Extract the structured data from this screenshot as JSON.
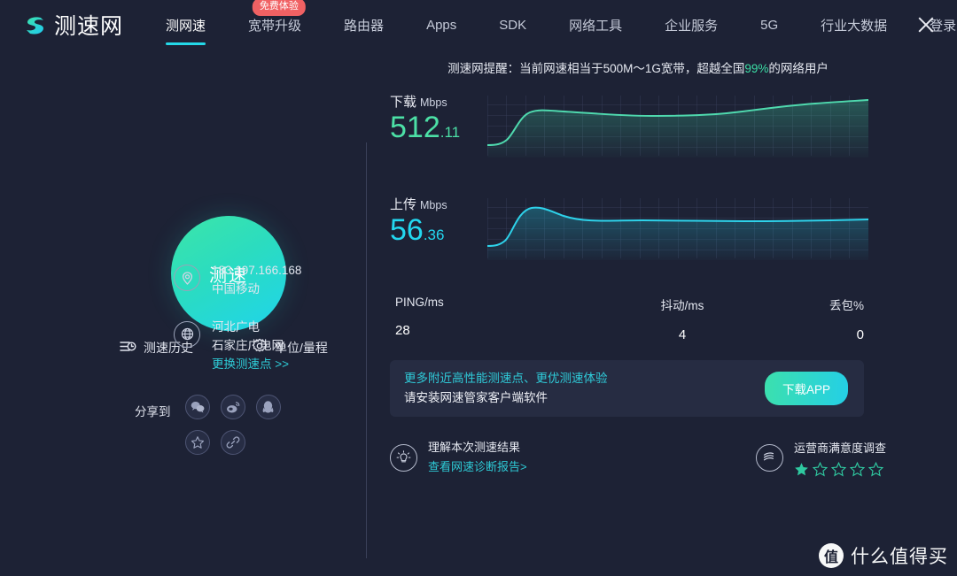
{
  "nav": {
    "logo_text": "测速网",
    "items": [
      {
        "label": "测网速",
        "active": true,
        "badge": null
      },
      {
        "label": "宽带升级",
        "active": false,
        "badge": "免费体验"
      },
      {
        "label": "路由器",
        "active": false,
        "badge": null
      },
      {
        "label": "Apps",
        "active": false,
        "badge": null
      },
      {
        "label": "SDK",
        "active": false,
        "badge": null
      },
      {
        "label": "网络工具",
        "active": false,
        "badge": null
      },
      {
        "label": "企业服务",
        "active": false,
        "badge": null
      },
      {
        "label": "5G",
        "active": false,
        "badge": null
      },
      {
        "label": "行业大数据",
        "active": false,
        "badge": null
      },
      {
        "label": "登录",
        "active": false,
        "badge": null
      }
    ],
    "close_icon": "close-icon"
  },
  "left": {
    "gauge_label": "测速",
    "history_label": "测速历史",
    "history_icon": "history-icon",
    "units_label": "单位/量程",
    "units_icon": "gear-icon",
    "ip_address": "183.197.166.168",
    "carrier": "中国移动",
    "location_icon": "location-pin-icon",
    "server_name": "河北广电",
    "server_network": "石家庄广电网",
    "server_icon": "globe-icon",
    "change_server": "更换测速点 >>",
    "share_label": "分享到",
    "share_items": [
      {
        "name": "wechat-icon",
        "glyph": "❤"
      },
      {
        "name": "weibo-icon",
        "glyph": "◎"
      },
      {
        "name": "qq-icon",
        "glyph": "●"
      },
      {
        "name": "favorite-star-icon",
        "glyph": "☆"
      },
      {
        "name": "link-icon",
        "glyph": "⚭"
      }
    ]
  },
  "right": {
    "reminder_prefix": "测速网提醒：",
    "reminder_body_1": "当前网速相当于500M～1G宽带，超越全国",
    "reminder_pct": "99%",
    "reminder_body_2": "的网络用户",
    "download": {
      "label": "下载",
      "unit": "Mbps",
      "int": "512",
      "dec": ".11",
      "color": "#4ce0a6"
    },
    "upload": {
      "label": "上传",
      "unit": "Mbps",
      "int": "56",
      "dec": ".36",
      "color": "#23d7ef"
    },
    "stats": [
      {
        "label": "PING/ms",
        "value": "28"
      },
      {
        "label": "抖动/ms",
        "value": "4"
      },
      {
        "label": "丢包%",
        "value": "0"
      }
    ],
    "promo": {
      "line1": "更多附近高性能测速点、更优测速体验",
      "line2": "请安装网速管家客户端软件",
      "button": "下载APP"
    },
    "diagnostic": {
      "icon": "lightbulb-icon",
      "title": "理解本次测速结果",
      "link": "查看网速诊断报告>"
    },
    "survey": {
      "icon": "china-mobile-icon",
      "title": "运营商满意度调查",
      "rating": 1,
      "total_stars": 5,
      "star_color": "#2fc9a0"
    }
  },
  "watermark": {
    "mark": "值",
    "text": "什么值得买"
  },
  "chart_data": [
    {
      "type": "line",
      "title": "下载 Mbps",
      "series_name": "download",
      "color": "#4ce0a6",
      "grid": true,
      "x": [
        0,
        5,
        10,
        15,
        20,
        25,
        30,
        35,
        40,
        45,
        50,
        55,
        60,
        65,
        70,
        75,
        80,
        85,
        90,
        95,
        100
      ],
      "values": [
        22,
        24,
        30,
        52,
        78,
        88,
        90,
        89,
        88,
        87,
        87,
        86,
        86,
        88,
        91,
        93,
        94,
        95,
        96,
        97,
        98
      ],
      "ylim": [
        0,
        100
      ],
      "ylabel": "Mbps"
    },
    {
      "type": "line",
      "title": "上传 Mbps",
      "series_name": "upload",
      "color": "#23d7ef",
      "grid": true,
      "x": [
        0,
        5,
        10,
        15,
        20,
        25,
        30,
        35,
        40,
        45,
        50,
        55,
        60,
        65,
        70,
        75,
        80,
        85,
        90,
        95,
        100
      ],
      "values": [
        18,
        20,
        28,
        55,
        82,
        92,
        91,
        86,
        81,
        79,
        78,
        77,
        77,
        76,
        76,
        76,
        75,
        75,
        75,
        74,
        74
      ],
      "ylim": [
        0,
        100
      ],
      "ylabel": "Mbps"
    }
  ]
}
